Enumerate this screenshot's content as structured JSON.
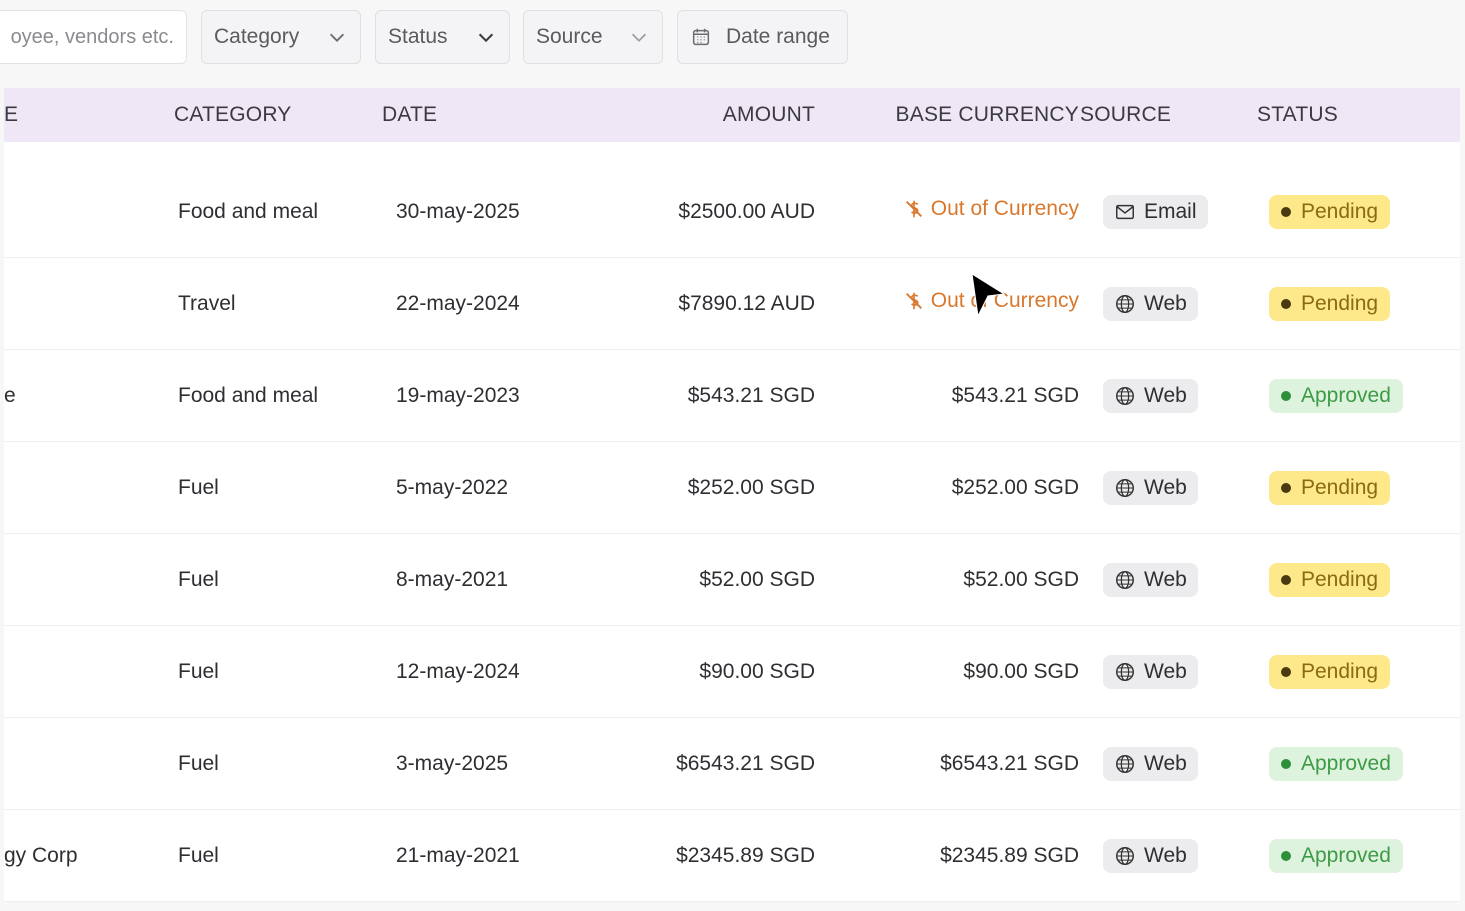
{
  "filters": {
    "search_value": "oyee, vendors etc.",
    "category_label": "Category",
    "status_label": "Status",
    "source_label": "Source",
    "date_label": "Date range"
  },
  "columns": {
    "name": "E",
    "category": "CATEGORY",
    "date": "DATE",
    "amount": "AMOUNT",
    "base_currency": "BASE CURRENCY",
    "source": "SOURCE",
    "status": "STATUS"
  },
  "colors": {
    "header_bg": "#efe6f6",
    "pending_bg": "#fde98a",
    "approved_bg": "#ddf3dd",
    "out_of_currency": "#d9782c"
  },
  "rows": [
    {
      "name": "",
      "category": "Food and meal",
      "date": "30-may-2025",
      "amount": "$2500.00 AUD",
      "base": "Out of Currency",
      "base_type": "ooc",
      "source": "Email",
      "source_icon": "mail-icon",
      "status": "Pending",
      "status_type": "pending"
    },
    {
      "name": "",
      "category": "Travel",
      "date": "22-may-2024",
      "amount": "$7890.12 AUD",
      "base": "Out of Currency",
      "base_type": "ooc",
      "source": "Web",
      "source_icon": "globe-icon",
      "status": "Pending",
      "status_type": "pending"
    },
    {
      "name": "e",
      "category": "Food and meal",
      "date": "19-may-2023",
      "amount": "$543.21 SGD",
      "base": "$543.21 SGD",
      "base_type": "value",
      "source": "Web",
      "source_icon": "globe-icon",
      "status": "Approved",
      "status_type": "approved"
    },
    {
      "name": "",
      "category": "Fuel",
      "date": "5-may-2022",
      "amount": "$252.00 SGD",
      "base": "$252.00 SGD",
      "base_type": "value",
      "source": "Web",
      "source_icon": "globe-icon",
      "status": "Pending",
      "status_type": "pending"
    },
    {
      "name": "",
      "category": "Fuel",
      "date": "8-may-2021",
      "amount": "$52.00 SGD",
      "base": "$52.00 SGD",
      "base_type": "value",
      "source": "Web",
      "source_icon": "globe-icon",
      "status": "Pending",
      "status_type": "pending"
    },
    {
      "name": "",
      "category": "Fuel",
      "date": "12-may-2024",
      "amount": "$90.00 SGD",
      "base": "$90.00 SGD",
      "base_type": "value",
      "source": "Web",
      "source_icon": "globe-icon",
      "status": "Pending",
      "status_type": "pending"
    },
    {
      "name": "",
      "category": "Fuel",
      "date": "3-may-2025",
      "amount": "$6543.21 SGD",
      "base": "$6543.21 SGD",
      "base_type": "value",
      "source": "Web",
      "source_icon": "globe-icon",
      "status": "Approved",
      "status_type": "approved"
    },
    {
      "name": "gy Corp",
      "category": "Fuel",
      "date": "21-may-2021",
      "amount": "$2345.89 SGD",
      "base": "$2345.89 SGD",
      "base_type": "value",
      "source": "Web",
      "source_icon": "globe-icon",
      "status": "Approved",
      "status_type": "approved"
    }
  ]
}
